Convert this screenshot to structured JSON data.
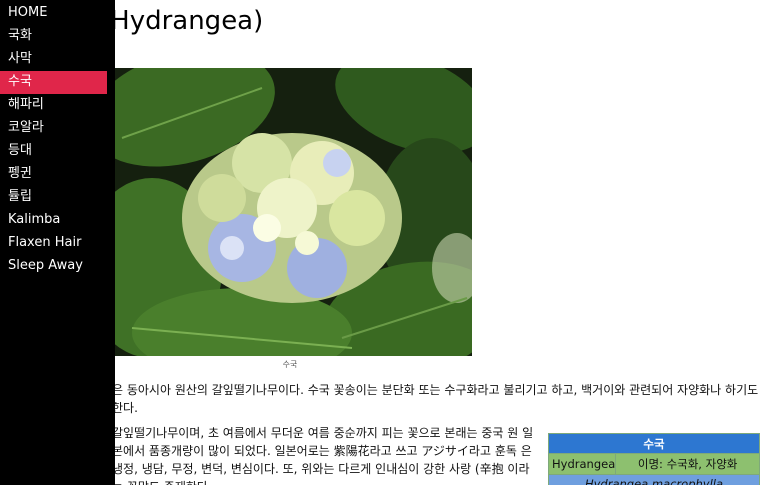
{
  "nav": {
    "items": [
      {
        "label": "HOME",
        "active": false
      },
      {
        "label": "국화",
        "active": false
      },
      {
        "label": "사막",
        "active": false
      },
      {
        "label": "수국",
        "active": true
      },
      {
        "label": "해파리",
        "active": false
      },
      {
        "label": "코알라",
        "active": false
      },
      {
        "label": "등대",
        "active": false
      },
      {
        "label": "펭귄",
        "active": false
      },
      {
        "label": "튤립",
        "active": false
      },
      {
        "label": "Kalimba",
        "active": false
      },
      {
        "label": "Flaxen Hair",
        "active": false
      },
      {
        "label": "Sleep Away",
        "active": false
      }
    ]
  },
  "page": {
    "title": "(Hydrangea)",
    "caption": "수국",
    "paragraph1": "은 동아시아 원산의 갈잎떨기나무이다. 수국 꽃송이는 분단화 또는 수구화라고 불리기고 하고, 백거이와 관련되어 자양화나 하기도 한다.",
    "paragraph2": "갈잎떨기나무이며, 초 여름에서 무더운 여름 중순까지 피는 꽃으로 본래는 중국 원 일본에서 품종개량이 많이 되었다. 일본어로는 紫陽花라고 쓰고 アジサイ라고 훈독 은 냉정, 냉담, 무정, 변덕, 변심이다. 또, 위와는 다르게 인내심이 강한 사랑 (辛抱 이라는 꽃말도 존재한다."
  },
  "infobox": {
    "title": "수국",
    "row_key": "Hydrangea",
    "row_value": "이명: 수국화, 자양화",
    "scientific_name": "Hydrangea macrophylla"
  },
  "colors": {
    "sidebar_bg": "#000000",
    "active_item": "#e0264a",
    "infobox_header": "#2d77d1",
    "infobox_row": "#8dc06f",
    "infobox_sci": "#6f9fdf"
  }
}
